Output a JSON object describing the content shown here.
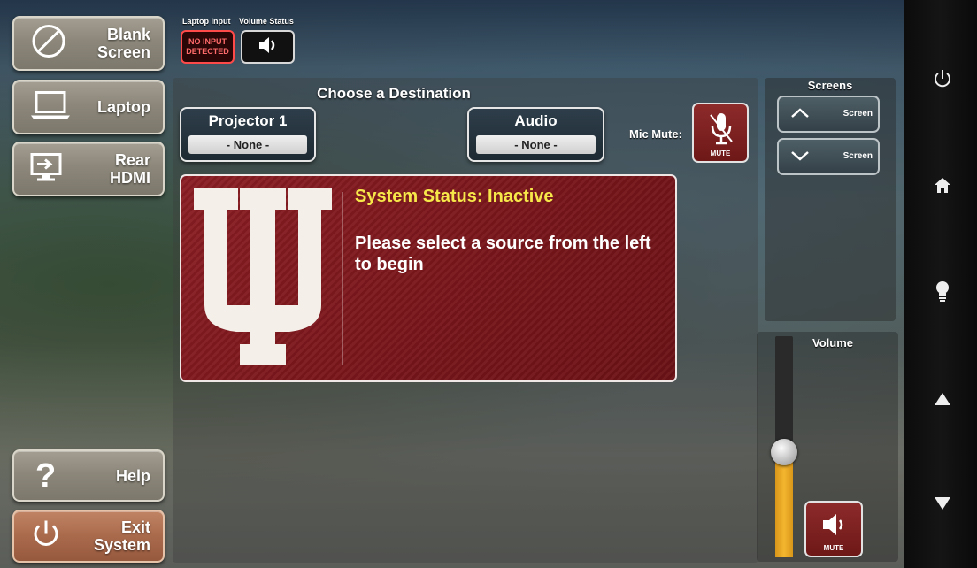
{
  "sources": {
    "blank_screen": {
      "label_line1": "Blank",
      "label_line2": "Screen"
    },
    "laptop": {
      "label": "Laptop"
    },
    "rear_hdmi": {
      "label_line1": "Rear",
      "label_line2": "HDMI"
    },
    "help": {
      "label": "Help"
    },
    "exit": {
      "label_line1": "Exit",
      "label_line2": "System"
    }
  },
  "indicators": {
    "laptop_input_caption": "Laptop Input",
    "volume_status_caption": "Volume Status",
    "no_input_line1": "NO INPUT",
    "no_input_line2": "DETECTED"
  },
  "destination": {
    "title": "Choose a Destination",
    "projector": {
      "name": "Projector 1",
      "value": "- None -"
    },
    "audio": {
      "name": "Audio",
      "value": "- None -"
    },
    "mic_mute_label": "Mic Mute:",
    "mic_mute_button": "MUTE"
  },
  "status": {
    "title": "System Status: Inactive",
    "message": "Please select a source from the left to begin"
  },
  "screens": {
    "title": "Screens",
    "up_label": "Screen",
    "down_label": "Screen"
  },
  "volume": {
    "title": "Volume",
    "level_percent": 50,
    "mute_label": "MUTE"
  },
  "colors": {
    "status_red": "#7a161b",
    "status_title_yellow": "#f7e84a",
    "volume_fill": "#f3b52e",
    "exit_orange": "#a96a4c"
  }
}
